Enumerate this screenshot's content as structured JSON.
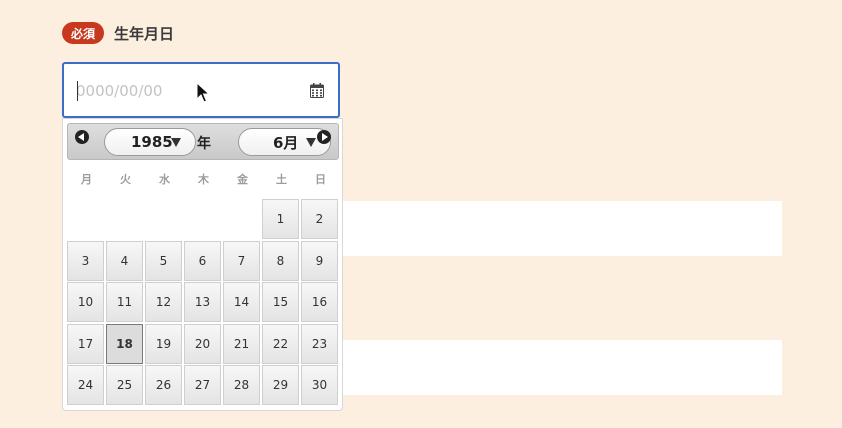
{
  "form": {
    "required_badge": "必須",
    "field_label": "生年月日",
    "date_input": {
      "value": "",
      "placeholder": "0000/00/00"
    },
    "icons": {
      "calendar": "calendar-icon"
    },
    "colors": {
      "badge": "#c8381e",
      "focus_border": "#3b6fc6",
      "page_bg": "#fcefe0"
    }
  },
  "datepicker": {
    "prev_icon": "chevron-left-icon",
    "next_icon": "chevron-right-icon",
    "year_selected": "1985",
    "year_suffix": "年",
    "month_selected": "6月",
    "weekdays": [
      "月",
      "火",
      "水",
      "木",
      "金",
      "土",
      "日"
    ],
    "leading_blank_days": 5,
    "days": [
      "1",
      "2",
      "3",
      "4",
      "5",
      "6",
      "7",
      "8",
      "9",
      "10",
      "11",
      "12",
      "13",
      "14",
      "15",
      "16",
      "17",
      "18",
      "19",
      "20",
      "21",
      "22",
      "23",
      "24",
      "25",
      "26",
      "27",
      "28",
      "29",
      "30"
    ],
    "selected_day": "18"
  }
}
